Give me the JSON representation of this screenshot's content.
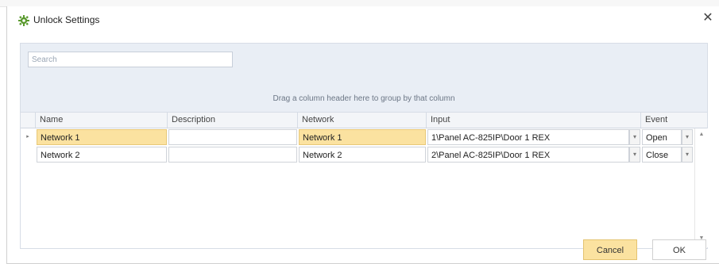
{
  "dialog": {
    "title": "Unlock Settings",
    "close_glyph": "✕",
    "title_icon": "gear-icon",
    "accent_color": "#fbe2a0"
  },
  "search": {
    "placeholder": "Search",
    "value": ""
  },
  "group_hint": "Drag a column header here to group by that column",
  "columns": [
    "Name",
    "Description",
    "Network",
    "Input",
    "Event"
  ],
  "rows": [
    {
      "indicator": "▸",
      "name": "Network 1",
      "description": "",
      "network": "Network 1",
      "input": "1\\Panel  AC-825IP\\Door 1 REX",
      "event": "Open",
      "selected": true
    },
    {
      "indicator": "",
      "name": "Network 2",
      "description": "",
      "network": "Network 2",
      "input": "2\\Panel  AC-825IP\\Door 1 REX",
      "event": "Close",
      "selected": false
    }
  ],
  "dropdown_glyph": "▾",
  "scroll": {
    "up_glyph": "▲",
    "down_glyph": "▼"
  },
  "buttons": {
    "cancel": "Cancel",
    "ok": "OK"
  }
}
